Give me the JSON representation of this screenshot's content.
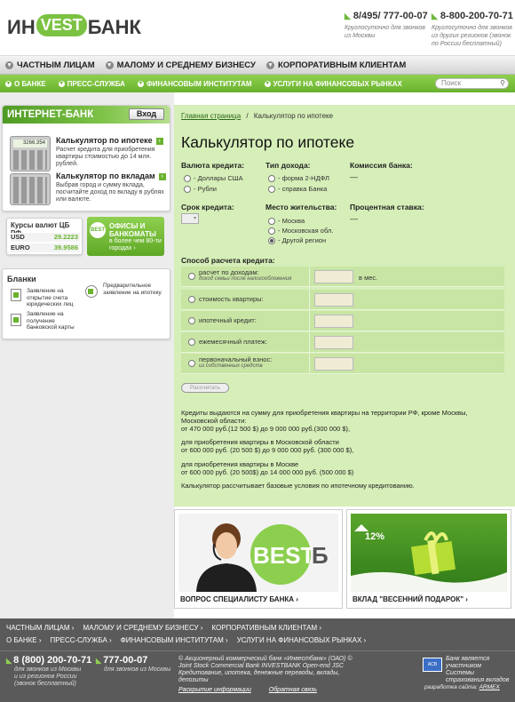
{
  "brand": {
    "logo_left": "ИН",
    "logo_mid": "VEST",
    "logo_right": "БАНК"
  },
  "header": {
    "phone1": "8/495/ 777-00-07",
    "phone1_note": "Круглосуточно для звонков из Москвы",
    "phone2": "8-800-200-70-71",
    "phone2_note": "Круглосуточно для звонков из других регионов (звонок по России бесплатный)"
  },
  "nav1": [
    "ЧАСТНЫМ ЛИЦАМ",
    "МАЛОМУ И СРЕДНЕМУ БИЗНЕСУ",
    "КОРПОРАТИВНЫМ КЛИЕНТАМ"
  ],
  "nav2": [
    "О БАНКЕ",
    "ПРЕСС-СЛУЖБА",
    "ФИНАНСОВЫМ ИНСТИТУТАМ",
    "УСЛУГИ НА ФИНАНСОВЫХ РЫНКАХ"
  ],
  "search": {
    "placeholder": "Поиск"
  },
  "ibank": {
    "title": "ИНТЕРНЕТ-БАНК",
    "login": "Вход",
    "calc_display": "3266.354",
    "mortgage_title": "Калькулятор по ипотеке",
    "mortgage_desc": "Расчет кредита для приобретения квартиры стоимостью до 14 млн. рублей.",
    "deposit_title": "Калькулятор по вкладам",
    "deposit_desc": "Выбрав город и сумму вклада, посчитайте доход по вкладу в рублях или валюте."
  },
  "rates": {
    "title": "Курсы валют ЦБ РФ",
    "usd_label": "USD",
    "usd": "29.2223",
    "eur_label": "EURO",
    "eur": "39.9586"
  },
  "offices": {
    "icon": "BEST",
    "title": "ОФИСЫ И БАНКОМАТЫ",
    "sub": "в более чем 80-ти городах ›"
  },
  "forms": {
    "title": "Бланки",
    "f1": "Заявление на открытие счета юридических лиц",
    "f2": "Предварительное заявление на ипотеку",
    "f3": "Заявление на получение банковской карты"
  },
  "breadcrumb": {
    "home": "Главная страница",
    "sep": "/",
    "current": "Калькулятор по ипотеке"
  },
  "page_title": "Калькулятор по ипотеке",
  "currency": {
    "label": "Валюта кредита:",
    "opt1": "- Доллары США",
    "opt2": "- Рубли"
  },
  "income": {
    "label": "Тип дохода:",
    "opt1": "- форма 2-НДФЛ",
    "opt2": "- справка Банка"
  },
  "commission": {
    "label": "Комиссия банка:",
    "value": "—"
  },
  "term": {
    "label": "Срок кредита:"
  },
  "residence": {
    "label": "Место жительства:",
    "opt1": "- Москва",
    "opt2": "- Московская обл.",
    "opt3": "- Другой регион",
    "selected": 3
  },
  "rate": {
    "label": "Процентная ставка:",
    "value": "—"
  },
  "method": {
    "label": "Способ расчета кредита:",
    "rows": [
      {
        "label": "расчет по доходам:",
        "sub": "доход семьи после налогообложения",
        "unit": "в мес."
      },
      {
        "label": "стоимость квартиры:"
      },
      {
        "label": "ипотечный кредит:"
      },
      {
        "label": "ежемесячный платеж:"
      },
      {
        "label": "первоначальный взнос:",
        "sub": "из собственных средств"
      }
    ]
  },
  "calc_button": "Рассчитать",
  "info": {
    "p1": "Кредиты выдаются на сумму для приобретения квартиры на территории РФ, кроме Москвы, Московской области:",
    "p1b": "от 470 000 руб.(12 500 $) до 9 000 000 руб.(300 000 $),",
    "p2": "для приобретения квартиры в Московской области",
    "p2b": "от 600 000 руб. (20 500 $) до 9 000 000 руб. (300 000 $),",
    "p3": "для приобретения квартиры в Москве",
    "p3b": "от 600 000 руб. (20 500$) до 14 000 000 руб. (500 000 $)",
    "p4": "Калькулятор рассчитывает базовые условия по ипотечному кредитованию."
  },
  "promo1": {
    "caption": "ВОПРОС СПЕЦИАЛИСТУ БАНКА ›",
    "logo": "И NVESTБАНК"
  },
  "promo2": {
    "caption": "ВКЛАД \"ВЕСЕННИЙ ПОДАРОК\" ›",
    "badge": "12%"
  },
  "footer": {
    "nav1": [
      "ЧАСТНЫМ ЛИЦАМ ›",
      "МАЛОМУ И СРЕДНЕМУ БИЗНЕСУ ›",
      "КОРПОРАТИВНЫМ КЛИЕНТАМ ›"
    ],
    "nav2": [
      "О БАНКЕ ›",
      "ПРЕСС-СЛУЖБА ›",
      "ФИНАНСОВЫМ ИНСТИТУТАМ ›",
      "УСЛУГИ НА ФИНАНСОВЫХ РЫНКАХ ›"
    ],
    "phone1": "8 (800) 200-70-71",
    "phone1_note": "для звонков из Москвы и из регионов России (звонок бесплатный)",
    "phone2": "777-00-07",
    "phone2_note": "для звонков из Москвы",
    "copy": "© Акционерный коммерческий банк «Инвестбанк» (ОАО) © Joint Stock Commercial Bank INVESTBANK Open-end JSC Кредитование, ипотека, денежные переводы, вклады, депозиты",
    "link1": "Раскрытие информации",
    "link2": "Обратная связь",
    "asv_text": "Банк является участником Системы страхования вкладов",
    "dev_label": "разработка сайта:",
    "dev_name": "ARMEX"
  }
}
